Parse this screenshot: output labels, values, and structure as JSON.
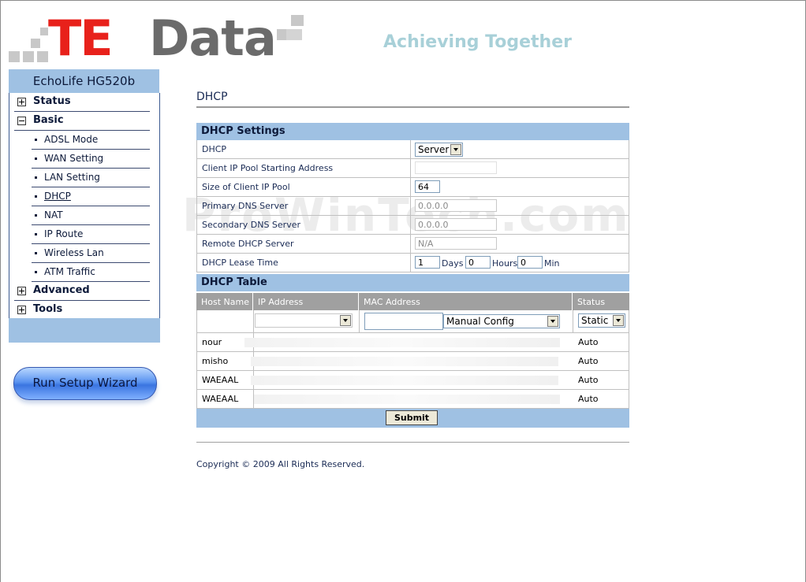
{
  "header": {
    "brand_te": "TE",
    "brand_data": "Data",
    "tagline": "Achieving Together"
  },
  "sidebar": {
    "device": "EchoLife HG520b",
    "items": [
      {
        "label": "Status",
        "type": "group",
        "expanded": false
      },
      {
        "label": "Basic",
        "type": "group",
        "expanded": true
      },
      {
        "label": "ADSL Mode",
        "type": "sub"
      },
      {
        "label": "WAN Setting",
        "type": "sub"
      },
      {
        "label": "LAN Setting",
        "type": "sub"
      },
      {
        "label": "DHCP",
        "type": "sub",
        "active": true
      },
      {
        "label": "NAT",
        "type": "sub"
      },
      {
        "label": "IP Route",
        "type": "sub"
      },
      {
        "label": "Wireless Lan",
        "type": "sub"
      },
      {
        "label": "ATM Traffic",
        "type": "sub"
      },
      {
        "label": "Advanced",
        "type": "group",
        "expanded": false
      },
      {
        "label": "Tools",
        "type": "group",
        "expanded": false
      }
    ],
    "wizard_label": "Run Setup Wizard"
  },
  "main": {
    "title": "DHCP",
    "settings": {
      "heading": "DHCP Settings",
      "dhcp_label": "DHCP",
      "dhcp_value": "Server",
      "pool_start_label": "Client IP Pool Starting Address",
      "pool_start_value": "",
      "pool_size_label": "Size of Client IP Pool",
      "pool_size_value": "64",
      "primary_dns_label": "Primary DNS Server",
      "primary_dns_value": "0.0.0.0",
      "secondary_dns_label": "Secondary DNS Server",
      "secondary_dns_value": "0.0.0.0",
      "remote_dhcp_label": "Remote DHCP Server",
      "remote_dhcp_value": "N/A",
      "lease_label": "DHCP Lease Time",
      "lease_days": "1",
      "days_unit": "Days",
      "lease_hours": "0",
      "hours_unit": "Hours",
      "lease_min": "0",
      "min_unit": "Min"
    },
    "table": {
      "heading": "DHCP Table",
      "columns": [
        "Host Name",
        "IP Address",
        "MAC Address",
        "Status"
      ],
      "mac_mode": "Manual Config",
      "status_mode": "Static",
      "rows": [
        {
          "host": "nour",
          "status": "Auto"
        },
        {
          "host": "misho",
          "status": "Auto"
        },
        {
          "host": "WAEAAL",
          "status": "Auto"
        },
        {
          "host": "WAEAAL",
          "status": "Auto"
        }
      ]
    },
    "submit_label": "Submit",
    "copyright": "Copyright © 2009 All Rights Reserved.",
    "watermark": "ProWinTech.com"
  },
  "colors": {
    "accent_blue": "#9fc1e3",
    "brand_red": "#e8211b",
    "brand_gray": "#6b6b6b",
    "table_header_gray": "#a0a0a0"
  }
}
